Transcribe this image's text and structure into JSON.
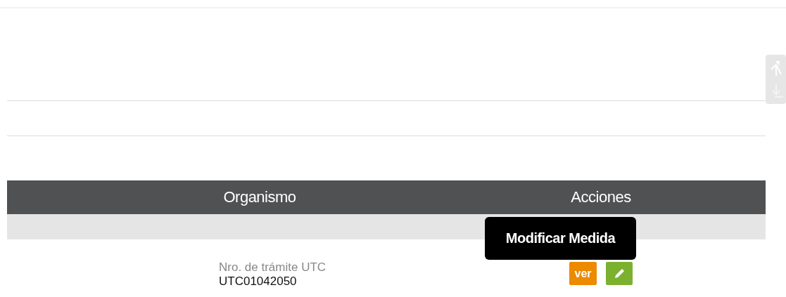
{
  "table": {
    "columns": [
      "Organismo",
      "Acciones"
    ],
    "rows": [
      {
        "label": "Nro. de trámite UTC",
        "value": "UTC01042050",
        "actions": [
          {
            "kind": "view",
            "label": "ver"
          },
          {
            "kind": "edit"
          }
        ]
      }
    ]
  },
  "tooltip": {
    "text": "Modificar Medida"
  }
}
